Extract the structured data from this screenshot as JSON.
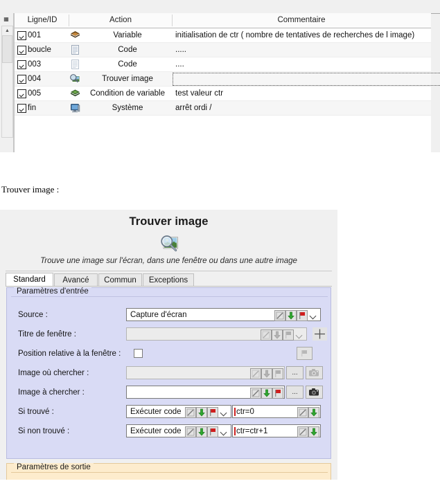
{
  "script_table": {
    "columns": [
      "Ligne/ID",
      "Action",
      "Commentaire"
    ],
    "rows": [
      {
        "id": "001",
        "icon": "variable-icon",
        "action": "Variable",
        "comment": "initialisation de ctr ( nombre de tentatives de recherches de l image)",
        "checked": true
      },
      {
        "id": "boucle",
        "icon": "code-icon",
        "action": "Code",
        "comment": ".....",
        "checked": true
      },
      {
        "id": "003",
        "icon": "code-icon",
        "action": "Code",
        "comment": "....",
        "checked": true
      },
      {
        "id": "004",
        "icon": "find-image-icon",
        "action": "Trouver image",
        "comment": "",
        "checked": true,
        "focused": true
      },
      {
        "id": "005",
        "icon": "condition-icon",
        "action": "Condition de variable",
        "comment": "test valeur ctr",
        "checked": true
      },
      {
        "id": "fin",
        "icon": "system-icon",
        "action": "Système",
        "comment": "arrêt ordi /",
        "checked": true
      }
    ]
  },
  "caption": "Trouver image :",
  "dialog": {
    "title": "Trouver image",
    "icon": "find-image-large-icon",
    "subtitle": "Trouve une image sur l'écran, dans une fenêtre ou dans une autre image",
    "tabs": [
      {
        "label": "Standard",
        "active": true
      },
      {
        "label": "Avancé",
        "active": false
      },
      {
        "label": "Commun",
        "active": false
      },
      {
        "label": "Exceptions",
        "active": false
      }
    ],
    "input_group": {
      "legend": "Paramètres d'entrée",
      "fields": [
        {
          "label": "Source :",
          "value": "Capture d'écran",
          "type": "combo",
          "enabled": true
        },
        {
          "label": "Titre de fenêtre :",
          "value": "",
          "type": "combo",
          "enabled": false,
          "extra": "crosshair-button"
        },
        {
          "label": "Position relative à la fenêtre :",
          "value": "",
          "type": "checkbox",
          "checked": false,
          "extra": "flag-button"
        },
        {
          "label": "Image où chercher :",
          "value": "",
          "type": "text",
          "enabled": false,
          "extra": "browse-camera"
        },
        {
          "label": "Image à chercher :",
          "value": "",
          "type": "text",
          "enabled": true,
          "extra": "browse-camera"
        },
        {
          "label": "Si trouvé :",
          "value": "Exécuter code",
          "type": "combo-code",
          "enabled": true,
          "code": "ctr=0"
        },
        {
          "label": "Si non trouvé :",
          "value": "Exécuter code",
          "type": "combo-code",
          "enabled": true,
          "code": "ctr=ctr+1"
        }
      ],
      "browse_label": "...",
      "colors": {
        "background": "#d9dbf5",
        "border": "#b9bce0"
      }
    },
    "output_group": {
      "legend": "Paramètres de sortie",
      "colors": {
        "background": "#fdeccd",
        "border": "#e4c99b"
      }
    }
  }
}
